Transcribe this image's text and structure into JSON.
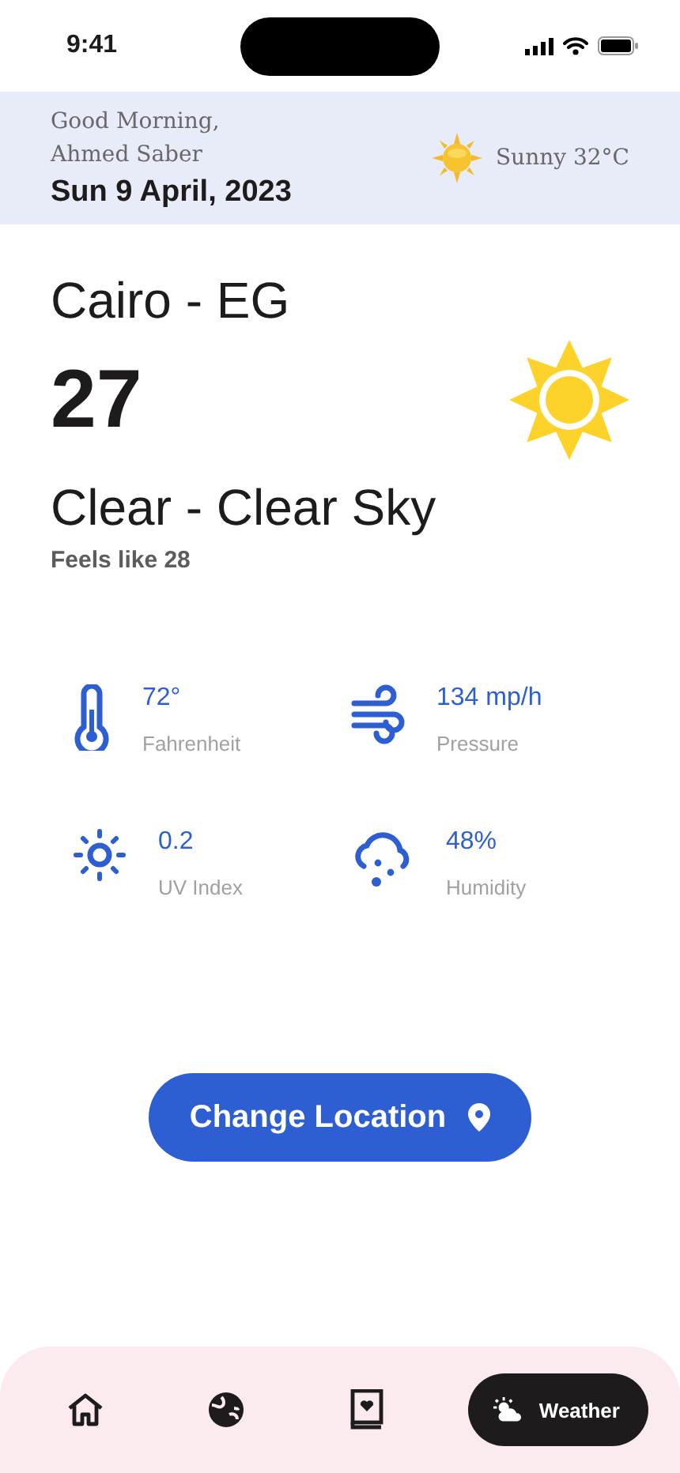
{
  "status_bar": {
    "time": "9:41"
  },
  "header": {
    "greeting": "Good Morning,",
    "name": "Ahmed Saber",
    "date": "Sun 9 April, 2023",
    "weather": "Sunny 32°C"
  },
  "current": {
    "city": "Cairo - EG",
    "temperature": "27",
    "condition": "Clear - Clear Sky",
    "feels_like": "Feels like 28"
  },
  "stats": [
    {
      "kind": "thermometer",
      "value": "72°",
      "label": "Fahrenheit"
    },
    {
      "kind": "wind",
      "value": "134 mp/h",
      "label": "Pressure"
    },
    {
      "kind": "uv",
      "value": "0.2",
      "label": "UV Index"
    },
    {
      "kind": "humidity",
      "value": "48%",
      "label": "Humidity"
    }
  ],
  "action_button": {
    "label": "Change Location"
  },
  "nav": [
    {
      "kind": "home",
      "selected": false
    },
    {
      "kind": "globe",
      "selected": false
    },
    {
      "kind": "book",
      "selected": false
    },
    {
      "kind": "weather",
      "selected": true,
      "label": "Weather"
    }
  ]
}
